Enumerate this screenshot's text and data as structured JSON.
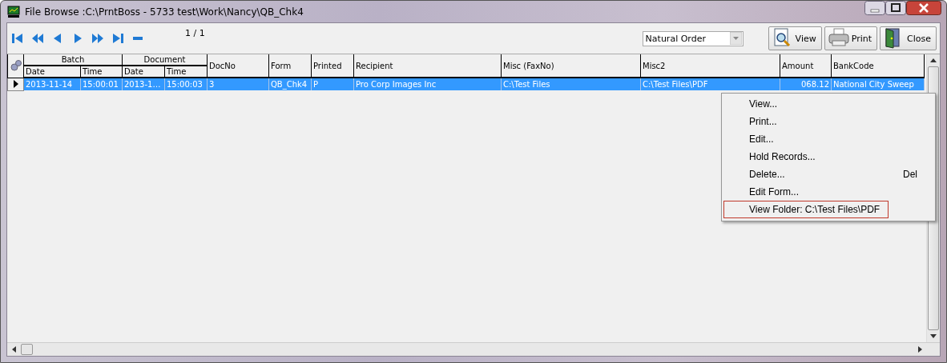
{
  "window": {
    "title": "File Browse :C:\\PrntBoss - 5733 test\\Work\\Nancy\\QB_Chk4"
  },
  "toolbar": {
    "page": "1 / 1",
    "order": {
      "value": "Natural Order"
    },
    "buttons": [
      {
        "kind": "view",
        "label": "View"
      },
      {
        "kind": "print",
        "label": "Print"
      },
      {
        "kind": "close",
        "label": "Close"
      }
    ]
  },
  "header_groups": [
    {
      "label": "Batch"
    },
    {
      "label": "Document"
    }
  ],
  "table": {
    "columns": [
      "Date",
      "Time",
      "Date",
      "Time",
      "DocNo",
      "Form",
      "Printed",
      "Recipient",
      "Misc (FaxNo)",
      "Misc2",
      "Amount",
      "BankCode"
    ],
    "rows": [
      {
        "selected": true,
        "cells": [
          "2013-11-14",
          "15:00:01",
          "2013-1…",
          "15:00:03",
          "3",
          "QB_Chk4",
          "P",
          "Pro Corp Images Inc",
          "C:\\Test Files",
          "C:\\Test Files\\PDF",
          "068.12",
          "National City Sweep"
        ]
      }
    ]
  },
  "context_menu": {
    "items": [
      {
        "label": "View...",
        "highlighted": false
      },
      {
        "label": "Print...",
        "highlighted": false
      },
      {
        "label": "Edit...",
        "highlighted": false
      },
      {
        "label": "Hold Records...",
        "highlighted": false
      },
      {
        "label": "Delete...",
        "shortcut": "Del",
        "highlighted": false
      },
      {
        "label": "Edit Form...",
        "highlighted": false
      },
      {
        "label": "View Folder: C:\\Test Files\\PDF",
        "highlighted": true
      }
    ]
  }
}
